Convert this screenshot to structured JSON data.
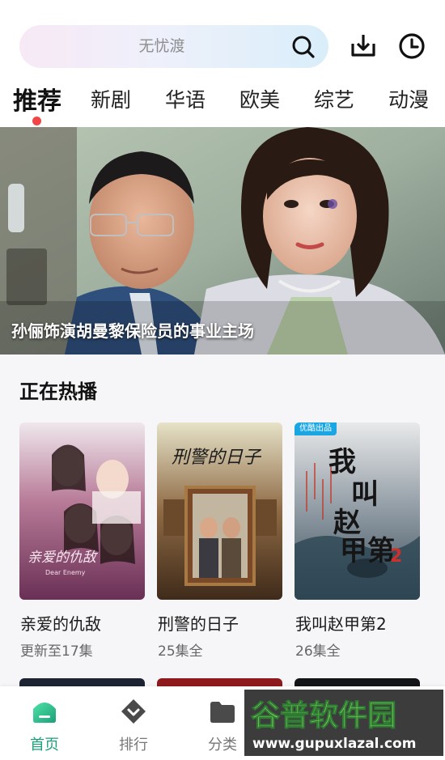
{
  "search": {
    "placeholder": "无忧渡"
  },
  "top_icons": [
    "search-icon",
    "download-icon",
    "history-icon"
  ],
  "tabs": [
    {
      "label": "推荐",
      "active": true
    },
    {
      "label": "新剧"
    },
    {
      "label": "华语"
    },
    {
      "label": "欧美"
    },
    {
      "label": "综艺"
    },
    {
      "label": "动漫"
    }
  ],
  "banner": {
    "caption": "孙俪饰演胡曼黎保险员的事业主场"
  },
  "now_playing": {
    "title": "正在热播",
    "items": [
      {
        "title": "亲爱的仇敌",
        "subtitle": "更新至17集",
        "poster_text": "亲爱的仇敌",
        "poster_sub": "Dear Enemy"
      },
      {
        "title": "刑警的日子",
        "subtitle": "25集全",
        "poster_text": "刑警的日子"
      },
      {
        "title": "我叫赵甲第2",
        "subtitle": "26集全",
        "poster_text": "我叫赵甲第",
        "badge": "优酷出品"
      }
    ]
  },
  "bottom_nav": [
    {
      "label": "首页",
      "icon": "home-icon",
      "active": true
    },
    {
      "label": "排行",
      "icon": "ranking-icon"
    },
    {
      "label": "分类",
      "icon": "folder-icon"
    }
  ],
  "watermark": {
    "text": "谷普软件园",
    "url": "www.gupuxlazal.com"
  },
  "colors": {
    "accent": "#1ca07a",
    "dot": "#f24545",
    "badge": "#1aa6e3"
  }
}
